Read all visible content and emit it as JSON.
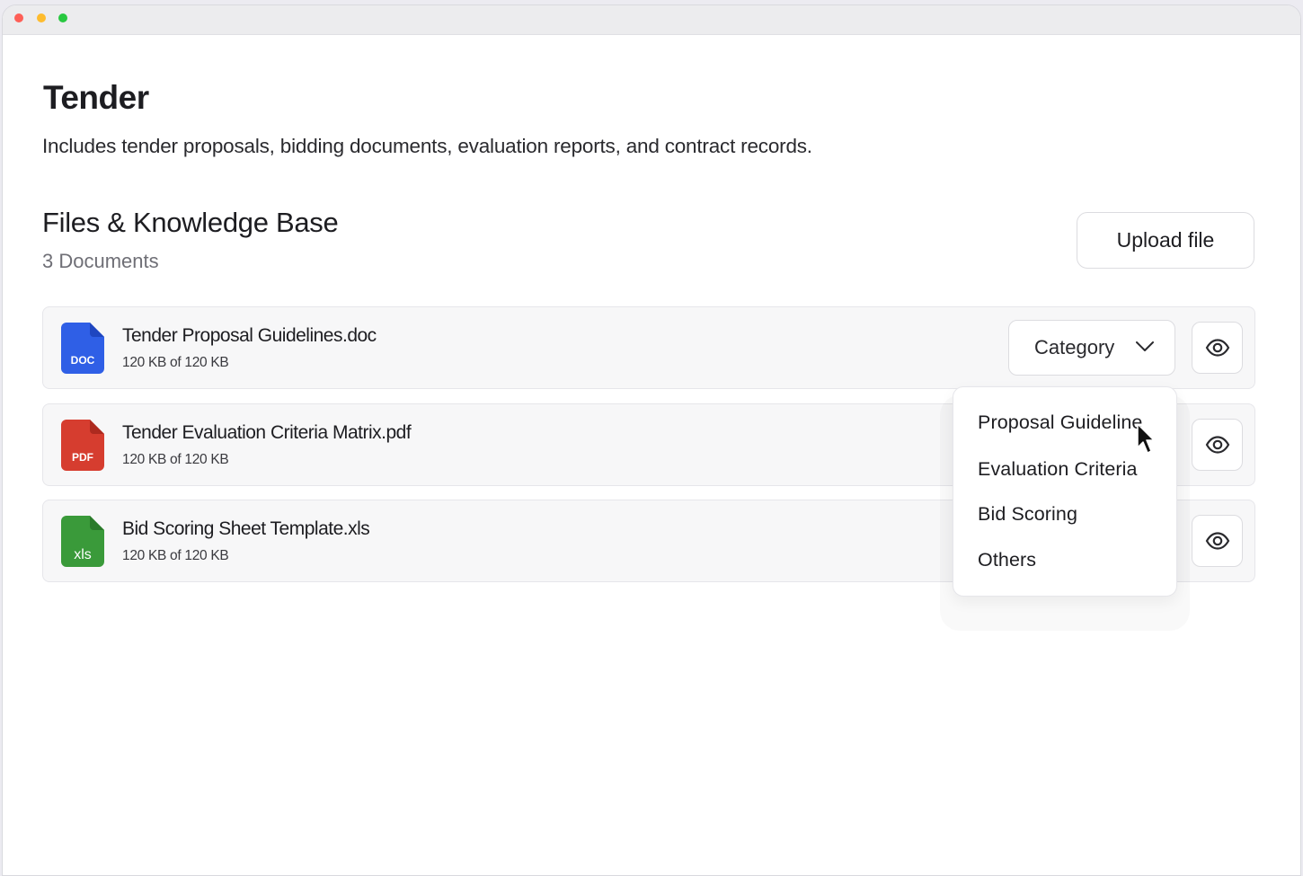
{
  "page": {
    "title": "Tender",
    "description": "Includes tender proposals, bidding documents, evaluation reports, and contract records."
  },
  "files_section": {
    "title": "Files & Knowledge Base",
    "count": "3 Documents",
    "upload_label": "Upload file"
  },
  "files": [
    {
      "name": "Tender Proposal Guidelines.doc",
      "size": "120 KB of 120 KB",
      "type_label": "DOC",
      "color": "#2f5fe6",
      "icon": "doc-file-icon"
    },
    {
      "name": "Tender Evaluation Criteria Matrix.pdf",
      "size": "120 KB of 120 KB",
      "type_label": "PDF",
      "color": "#d63d2f",
      "icon": "pdf-file-icon"
    },
    {
      "name": "Bid Scoring Sheet Template.xls",
      "size": "120 KB of 120 KB",
      "type_label": "xls",
      "color": "#3a9a3a",
      "icon": "xls-file-icon"
    }
  ],
  "category_select": {
    "label": "Category",
    "options": [
      "Proposal Guideline",
      "Evaluation Criteria",
      "Bid Scoring",
      "Others"
    ]
  },
  "icons": {
    "view": "eye-icon",
    "chevron": "chevron-down-icon",
    "cursor": "mouse-pointer-icon"
  }
}
